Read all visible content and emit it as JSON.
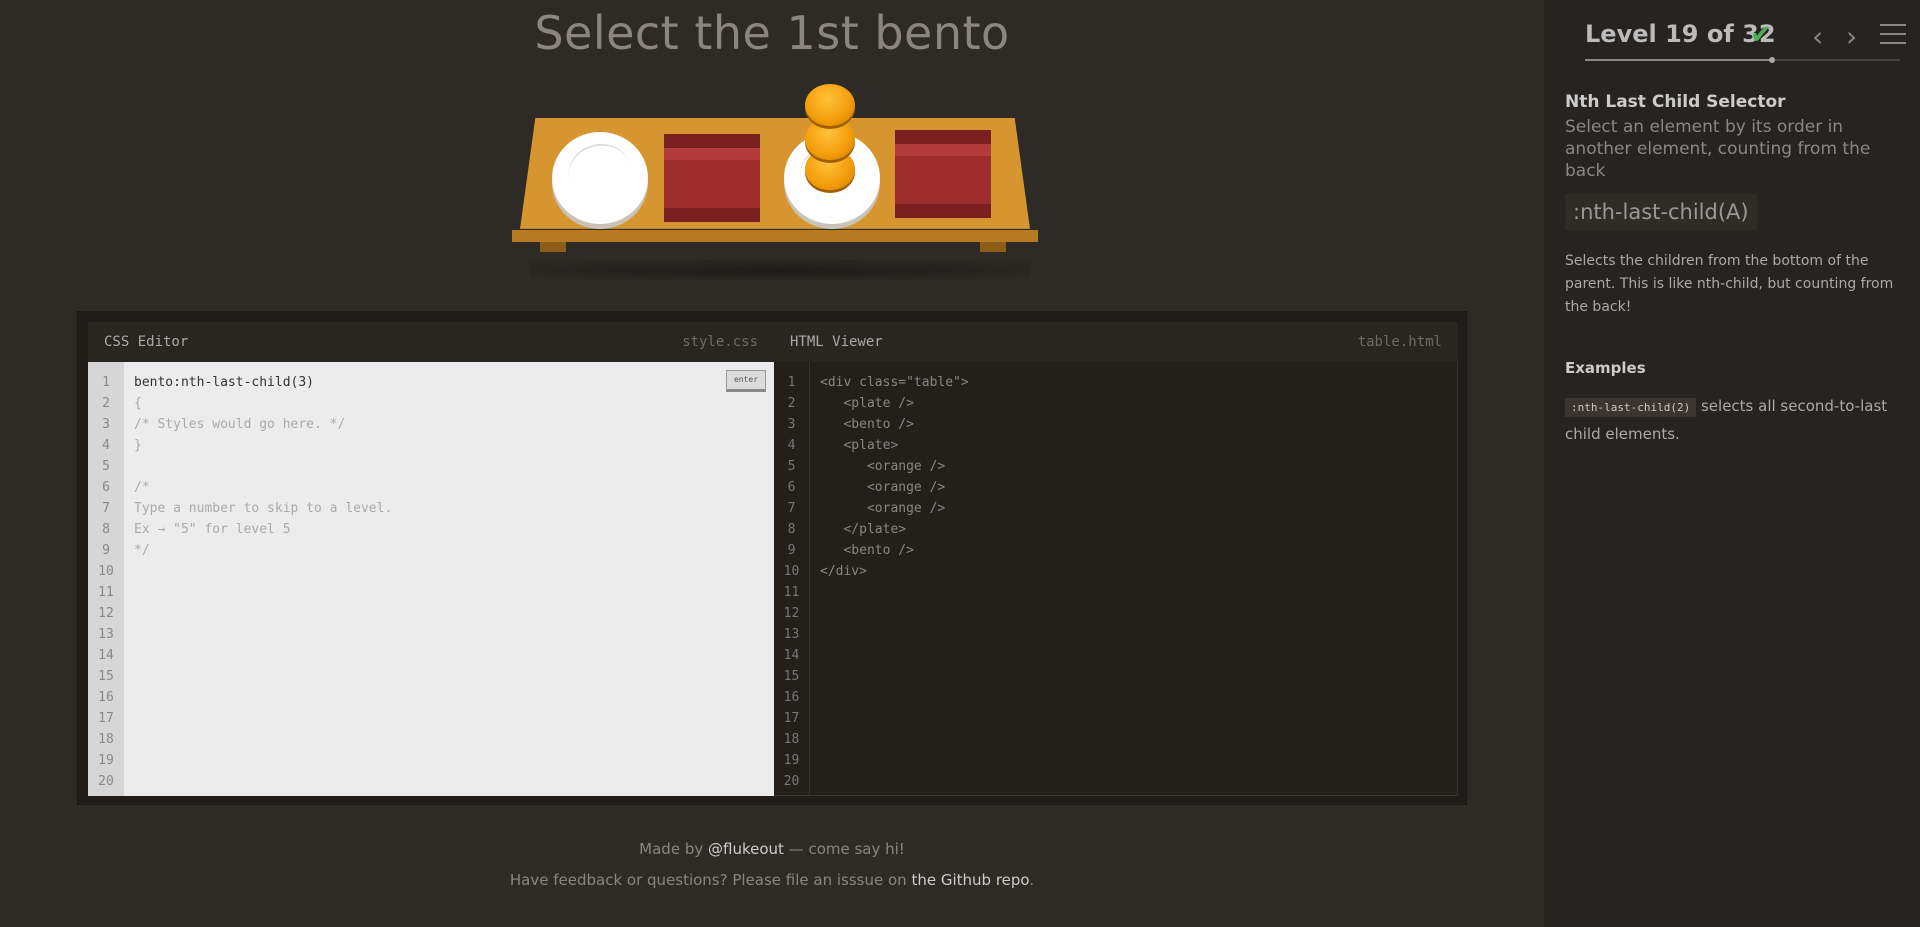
{
  "instruction": "Select the 1st bento",
  "css_editor": {
    "title": "CSS Editor",
    "filename": "style.css",
    "enter_label": "enter",
    "lines": [
      "1",
      "2",
      "3",
      "4",
      "5",
      "6",
      "7",
      "8",
      "9",
      "10",
      "11",
      "12",
      "13",
      "14",
      "15",
      "16",
      "17",
      "18",
      "19",
      "20"
    ],
    "input_value": "bento:nth-last-child(3)",
    "code_lines": [
      "{",
      "/* Styles would go here. */",
      "}",
      "",
      "/*",
      "Type a number to skip to a level.",
      "Ex → \"5\" for level 5",
      "*/"
    ]
  },
  "html_viewer": {
    "title": "HTML Viewer",
    "filename": "table.html",
    "lines": [
      "1",
      "2",
      "3",
      "4",
      "5",
      "6",
      "7",
      "8",
      "9",
      "10",
      "11",
      "12",
      "13",
      "14",
      "15",
      "16",
      "17",
      "18",
      "19",
      "20"
    ],
    "code_lines": [
      "<div class=\"table\">",
      "   <plate />",
      "   <bento />",
      "   <plate>",
      "      <orange />",
      "      <orange />",
      "      <orange />",
      "   </plate>",
      "   <bento />",
      "</div>"
    ]
  },
  "footer": {
    "made_by_prefix": "Made by ",
    "made_by_link": "@flukeout",
    "made_by_suffix": " — come say hi!",
    "feedback_prefix": "Have feedback or questions? Please file an isssue on ",
    "feedback_link": "the Github repo",
    "feedback_suffix": "."
  },
  "sidebar": {
    "level_label": "Level 19 of 32",
    "level_complete": true,
    "progress": 0.594,
    "selector_name": "Nth Last Child Selector",
    "selector_title": "Select an element by its order in another element, counting from the back",
    "syntax": ":nth-last-child(A)",
    "hint": "Selects the children from the bottom of the parent. This is like nth-child, but counting from the back!",
    "examples_title": "Examples",
    "example_code": ":nth-last-child(2)",
    "example_text": " selects all second-to-last child elements."
  },
  "colors": {
    "background": "#2e2a26",
    "sidebar": "#262320",
    "table": "#d6952f",
    "bento": "#a02d2d",
    "orange": "#f39c0a",
    "check": "#4caf50"
  }
}
